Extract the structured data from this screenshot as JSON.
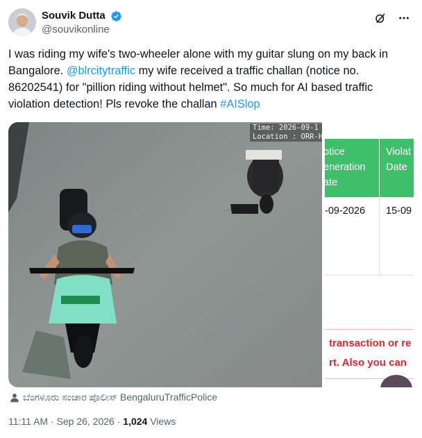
{
  "author": {
    "display_name": "Souvik Dutta",
    "handle": "@souvikonline",
    "verified": true,
    "avatar_icon": "user-avatar"
  },
  "header_actions": [
    "grok-icon",
    "more-icon"
  ],
  "tweet": {
    "text_1": "I was riding my wife's two-wheeler alone with my guitar slung on my back in Bangalore. ",
    "mention": "@blrcitytraffic",
    "text_2": " my wife received a traffic challan (notice no. 86202541) for \"pillion riding without helmet\". So much for AI based traffic violation detection! Pls revoke the challan ",
    "hashtag": "#AISlop"
  },
  "media": {
    "cctv_overlay_line1": "Time: 2026-09-1",
    "cctv_overlay_line2": "Location : ORR-H",
    "document": {
      "col1_header": "otice\neneration\nate",
      "col2_header": "Violat\nDate",
      "col1_value": "-09-2026",
      "col2_value": "15-09",
      "error_line1": "transaction or re",
      "error_line2": "rt. Also you can "
    }
  },
  "caption": {
    "icon": "person-icon",
    "text": "ಬೆಂಗಳೂರು ಸಂಚಾರ ಪೊಲೀಸ್ BengaluruTrafficPolice"
  },
  "meta": {
    "time": "11:11 AM",
    "separator": " · ",
    "date": "Sep 26, 2026",
    "views_count": "1,024",
    "views_label": " Views"
  },
  "colors": {
    "link": "#1d9bf0",
    "secondary_text": "#536471",
    "header_green": "#3fbf6a",
    "error_red": "#e0262c"
  }
}
